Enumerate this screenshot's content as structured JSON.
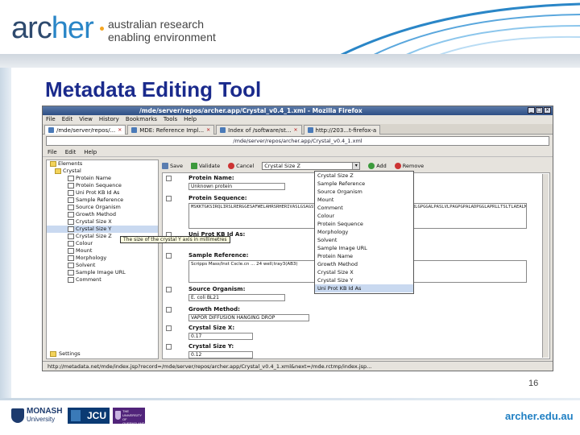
{
  "slide": {
    "logo_text_main": "arc",
    "logo_text_accent": "her",
    "logo_tagline_1": "australian research",
    "logo_tagline_2": "enabling environment",
    "title": "Metadata Editing Tool",
    "page_number": "16",
    "footer_url": "archer.edu.au",
    "footer_logos": {
      "monash_name": "MONASH",
      "monash_sub": "University",
      "jcu": "JCU",
      "uq_line1": "THE UNIVERSITY",
      "uq_line2": "OF QUEENSLAND",
      "uq_line3": "AUSTRALIA"
    },
    "colors": {
      "title": "#1a2a8c",
      "accent": "#2a86c7",
      "footer_url": "#1f7fc3"
    }
  },
  "browser": {
    "window_title": "/mde/server/repos/archer.app/Crystal_v0.4_1.xml - Mozilla Firefox",
    "window_buttons": [
      "_",
      "□",
      "×"
    ],
    "menu": [
      "File",
      "Edit",
      "View",
      "History",
      "Bookmarks",
      "Tools",
      "Help"
    ],
    "tabs": [
      {
        "label": "/mde/server/repos/...",
        "active": true
      },
      {
        "label": "MDE: Reference Impl..."
      },
      {
        "label": "Index of /software/st..."
      },
      {
        "label": "http://203...t-firefox-a"
      }
    ],
    "url": "/mde/server/repos/archer.app/Crystal_v0.4_1.xml",
    "status_url": "http://metadata.net/mde/index.jsp?record=/mde/server/repos/archer.app/Crystal_v0.4_1.xml&next=/mde.rctmp/index.jsp..."
  },
  "app": {
    "menu": [
      "File",
      "Edit",
      "Help"
    ],
    "toolbar": {
      "save": "Save",
      "validate": "Validate",
      "cancel": "Cancel",
      "element_select_value": "Crystal Size Z",
      "add": "Add",
      "remove": "Remove"
    },
    "tree": {
      "root": "Elements",
      "group": "Crystal",
      "items": [
        "Protein Name",
        "Protein Sequence",
        "Uni Prot KB Id As",
        "Sample Reference",
        "Source Organism",
        "Growth Method",
        "Crystal Size X",
        "Crystal Size Y",
        "Crystal Size Z",
        "Colour",
        "Mount",
        "Morphology",
        "Solvent",
        "Sample Image URL",
        "Comment"
      ],
      "selected_index": 7,
      "settings": "Settings",
      "tooltip": "The size of the crystal Y axis in millimetres"
    },
    "fields": [
      {
        "label": "Protein Name:",
        "value": "Unknown protein"
      },
      {
        "label": "Protein Sequence:",
        "value": "MSKKTGKSIRQLIRSLRERGGESAFWELAHRSRHERIVASLGSAGSVGEKLLLIALMIGRAAALTSRAVTMAAPLTLAGILLSRLGPGGALPASLVLPAGPGPALADPGGLAPRLLTSLTLAEALMSAVDGGSAALRLELASGHLRSVVLAASQGRGMLDARLG"
      },
      {
        "label": "Uni Prot KB Id As:",
        "value": ""
      },
      {
        "label": "Sample Reference:",
        "value": "Scripps Mass/Inst Cscle.cn ... 24 well;tray3(AB3)"
      },
      {
        "label": "Source Organism:",
        "value": "E. coli BL21"
      },
      {
        "label": "Growth Method:",
        "value": "VAPOR DIFFUSION HANGING DROP"
      },
      {
        "label": "Crystal Size X:",
        "value": "0.17"
      },
      {
        "label": "Crystal Size Y:",
        "value": "0.12"
      }
    ],
    "dropdown_options": [
      "Crystal Size Z",
      "Sample Reference",
      "Source Organism",
      "Mount",
      "Comment",
      "Colour",
      "Protein Sequence",
      "Morphology",
      "Solvent",
      "Sample Image URL",
      "Protein Name",
      "Growth Method",
      "Crystal Size X",
      "Crystal Size Y",
      "Uni Prot KB Id As"
    ]
  }
}
